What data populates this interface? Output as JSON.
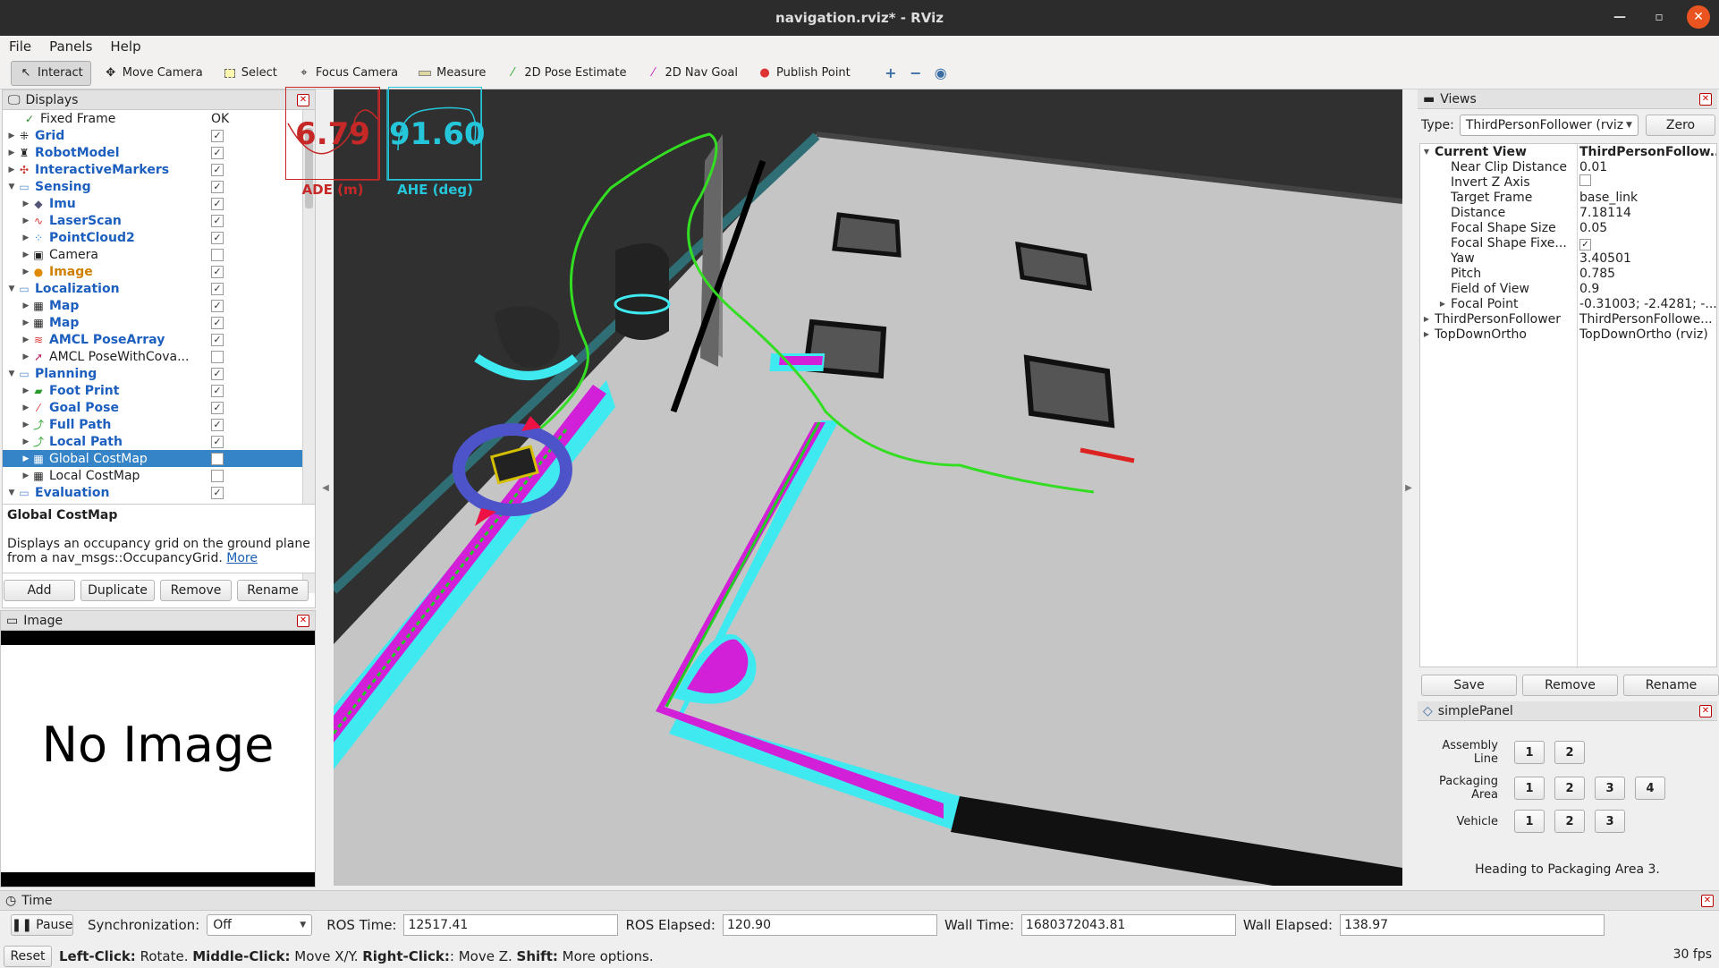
{
  "window": {
    "title": "navigation.rviz* - RViz"
  },
  "menu": [
    "File",
    "Panels",
    "Help"
  ],
  "toolbar": {
    "interact": "Interact",
    "move_camera": "Move Camera",
    "select": "Select",
    "focus_camera": "Focus Camera",
    "measure": "Measure",
    "pose_estimate": "2D Pose Estimate",
    "nav_goal": "2D Nav Goal",
    "publish_point": "Publish Point"
  },
  "displays": {
    "title": "Displays",
    "rows": [
      {
        "label": "Fixed Frame",
        "value": "OK"
      },
      {
        "label": "Grid"
      },
      {
        "label": "RobotModel"
      },
      {
        "label": "InteractiveMarkers"
      },
      {
        "label": "Sensing"
      },
      {
        "label": "Imu"
      },
      {
        "label": "LaserScan"
      },
      {
        "label": "PointCloud2"
      },
      {
        "label": "Camera"
      },
      {
        "label": "Image"
      },
      {
        "label": "Localization"
      },
      {
        "label": "Map"
      },
      {
        "label": "Map"
      },
      {
        "label": "AMCL PoseArray"
      },
      {
        "label": "AMCL PoseWithCova..."
      },
      {
        "label": "Planning"
      },
      {
        "label": "Foot Print"
      },
      {
        "label": "Goal Pose"
      },
      {
        "label": "Full Path"
      },
      {
        "label": "Local Path"
      },
      {
        "label": "Global CostMap"
      },
      {
        "label": "Local CostMap"
      },
      {
        "label": "Evaluation"
      }
    ],
    "description_title": "Global CostMap",
    "description_text": "Displays an occupancy grid on the ground plane from a nav_msgs::OccupancyGrid.",
    "description_link": "More",
    "buttons": [
      "Add",
      "Duplicate",
      "Remove",
      "Rename"
    ]
  },
  "image_panel": {
    "title": "Image",
    "placeholder": "No Image"
  },
  "overlay": {
    "ade_value": "6.79",
    "ade_label": "ADE (m)",
    "ahe_value": "91.60",
    "ahe_label": "AHE (deg)"
  },
  "views": {
    "title": "Views",
    "type_label": "Type:",
    "type_value": "ThirdPersonFollower (rviz",
    "zero": "Zero",
    "props": [
      {
        "key": "Current View",
        "value": "ThirdPersonFollow..."
      },
      {
        "key": "Near Clip Distance",
        "value": "0.01"
      },
      {
        "key": "Invert Z Axis",
        "value": ""
      },
      {
        "key": "Target Frame",
        "value": "base_link"
      },
      {
        "key": "Distance",
        "value": "7.18114"
      },
      {
        "key": "Focal Shape Size",
        "value": "0.05"
      },
      {
        "key": "Focal Shape Fixe...",
        "value": ""
      },
      {
        "key": "Yaw",
        "value": "3.40501"
      },
      {
        "key": "Pitch",
        "value": "0.785"
      },
      {
        "key": "Field of View",
        "value": "0.9"
      },
      {
        "key": "Focal Point",
        "value": "-0.31003; -2.4281; -..."
      },
      {
        "key": "ThirdPersonFollower",
        "value": "ThirdPersonFollowe..."
      },
      {
        "key": "TopDownOrtho",
        "value": "TopDownOrtho (rviz)"
      }
    ],
    "buttons": [
      "Save",
      "Remove",
      "Rename"
    ]
  },
  "simple_panel": {
    "title": "simplePanel",
    "assembly_label": "Assembly Line",
    "packaging_label": "Packaging Area",
    "vehicle_label": "Vehicle",
    "assembly_buttons": [
      "1",
      "2"
    ],
    "packaging_buttons": [
      "1",
      "2",
      "3",
      "4"
    ],
    "vehicle_buttons": [
      "1",
      "2",
      "3"
    ],
    "status": "Heading to Packaging Area 3."
  },
  "time": {
    "title": "Time",
    "pause": "Pause",
    "sync_label": "Synchronization:",
    "sync_value": "Off",
    "ros_time_label": "ROS Time:",
    "ros_time": "12517.41",
    "ros_elapsed_label": "ROS Elapsed:",
    "ros_elapsed": "120.90",
    "wall_time_label": "Wall Time:",
    "wall_time": "1680372043.81",
    "wall_elapsed_label": "Wall Elapsed:",
    "wall_elapsed": "138.97"
  },
  "statusbar": {
    "reset": "Reset",
    "left_click": "Left-Click:",
    "left_click_desc": " Rotate. ",
    "middle_click": "Middle-Click:",
    "middle_click_desc": " Move X/Y. ",
    "right_click": "Right-Click:",
    "right_click_desc": ": Move Z. ",
    "shift": "Shift:",
    "shift_desc": " More options.",
    "fps": "30 fps"
  },
  "colors": {
    "accent_selected": "#3584c8",
    "ade_red": "#c62828",
    "ahe_cyan": "#26c6da",
    "costmap_cyan": "#3fe9f0",
    "costmap_magenta": "#d21fd8",
    "path_green": "#33dd22"
  }
}
